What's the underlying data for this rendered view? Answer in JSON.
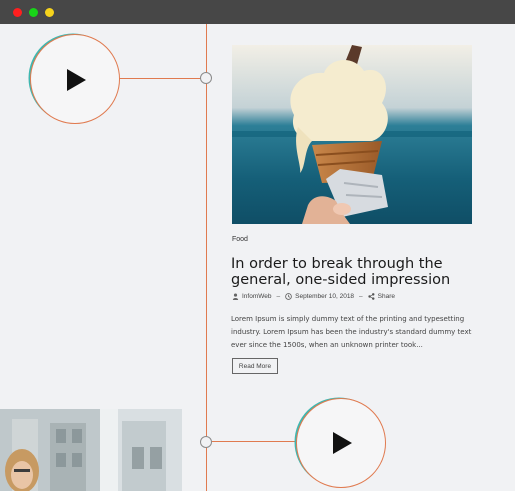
{
  "window": {
    "controls": [
      "close",
      "maximize",
      "minimize"
    ]
  },
  "post": {
    "category": "Food",
    "title": "In order to break through the general, one-sided impression",
    "author": "InfomWeb",
    "date": "September 10, 2018",
    "share_label": "Share",
    "excerpt": "Lorem Ipsum is simply dummy text of the printing and typesetting industry. Lorem Ipsum has been the industry's standard dummy text ever since the 1500s, when an unknown printer took...",
    "read_more_label": "Read More"
  },
  "icons": {
    "author": "user-icon",
    "date": "clock-icon",
    "share": "share-icon",
    "play": "play-icon"
  },
  "colors": {
    "timeline": "#e07a4f",
    "play_ring_accent": "#3fb7b0",
    "titlebar": "#474747"
  }
}
